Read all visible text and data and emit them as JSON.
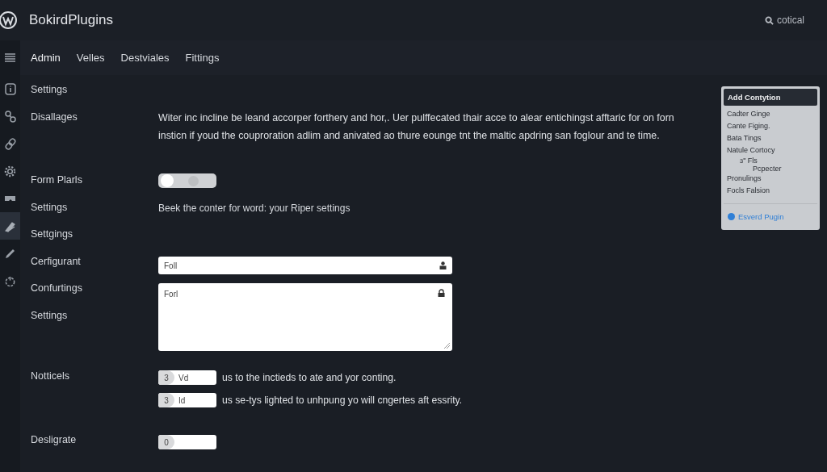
{
  "header": {
    "title": "BokirdPlugins",
    "search": {
      "value": "cotical"
    }
  },
  "tabs": [
    {
      "label": "Admin",
      "selected": true
    },
    {
      "label": "Velles",
      "selected": false
    },
    {
      "label": "Destviales",
      "selected": false
    },
    {
      "label": "Fittings",
      "selected": false
    }
  ],
  "sidebar": {
    "items": [
      {
        "selected": false
      },
      {
        "selected": false
      },
      {
        "selected": false
      },
      {
        "selected": false
      },
      {
        "selected": false
      },
      {
        "selected": true
      },
      {
        "selected": false
      },
      {
        "selected": false
      }
    ]
  },
  "labels": [
    "Settings",
    "Disallages",
    "Form Plarls",
    "Settings",
    "Settgings",
    "Cerfigurant",
    "Confurtings",
    "Settings",
    "Notticels",
    "Desligrate"
  ],
  "form": [
    {
      "kind": "paragraph",
      "text": "Witer inc incline be leand accorper forthery and hor,. Uer pulffecated thair acce to alear entichingst afftaric for on forn insticn if youd the couproration adlim and anivated ao thure eounge tnt the maltic apdring san foglour and te time."
    },
    {
      "kind": "toggle",
      "on": false
    },
    {
      "kind": "note",
      "text": "Beek the conter for word: your Riper settings"
    },
    {
      "kind": "input",
      "value": "Foll"
    },
    {
      "kind": "textarea",
      "value": "Forl"
    },
    {
      "kind": "number",
      "count": "3",
      "value": "Vd",
      "text": "us to the inctieds to ate and yor conting."
    },
    {
      "kind": "number",
      "count": "3",
      "value": "Id",
      "text": "us se-tys lighted to unhpung yo will cngertes aft essrity."
    },
    {
      "kind": "number",
      "count": "0"
    }
  ],
  "panel": {
    "title": "Add Contytion",
    "items": [
      {
        "label": "Cadter Ginge"
      },
      {
        "label": "Cante Figing."
      },
      {
        "label": "Bata Tings"
      },
      {
        "label": "Natule Cortocy",
        "children": [
          {
            "label": "ɜ\" Fls",
            "children": [
              {
                "label": "Pcpecter"
              }
            ]
          }
        ]
      },
      {
        "label": "Pronulings"
      },
      {
        "label": "Focls Falsion"
      }
    ],
    "link": "Esverd Pugin"
  }
}
